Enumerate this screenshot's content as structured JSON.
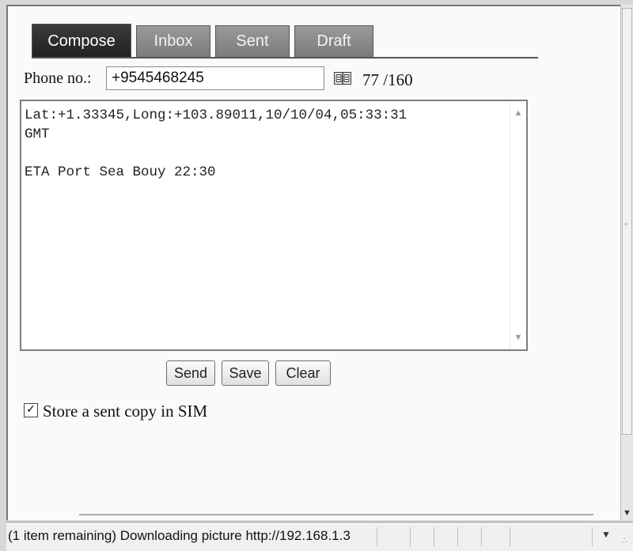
{
  "tabs": [
    {
      "label": "Compose",
      "active": true
    },
    {
      "label": "Inbox",
      "active": false
    },
    {
      "label": "Sent",
      "active": false
    },
    {
      "label": "Draft",
      "active": false
    }
  ],
  "compose": {
    "phone_label": "Phone no.:",
    "phone_value": "+9545468245",
    "phonebook_icon": "phonebook-icon",
    "char_counter": "77 /160",
    "message_lines": [
      "Lat:+1.33345,Long:+103.89011,10/10/04,05:33:31",
      "GMT",
      "",
      "ETA Port Sea Bouy 22:30"
    ],
    "buttons": {
      "send": "Send",
      "save": "Save",
      "clear": "Clear"
    },
    "store_copy_label": "Store a sent copy in SIM",
    "store_copy_checked": true
  },
  "status_bar": {
    "text": "(1 item remaining) Downloading picture http://192.168.1.3"
  }
}
